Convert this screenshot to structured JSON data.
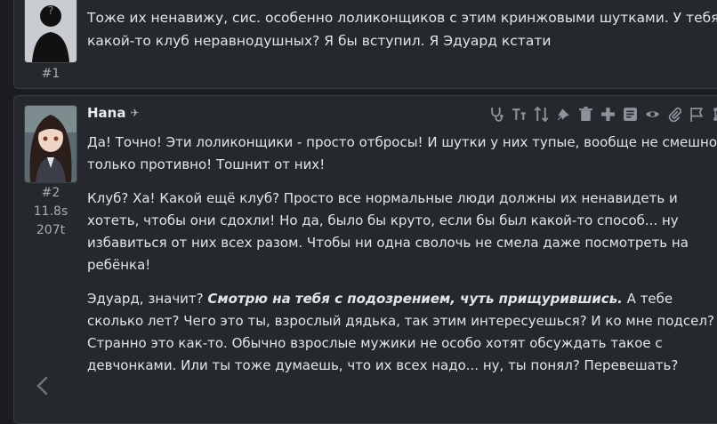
{
  "messages": [
    {
      "number": "#1",
      "text": "Тоже их ненавижу, сис. особенно лоликонщиков с этим кринжовыми шутками. У тебя какой-то клуб неравнодушных? Я бы вступил. Я Эдуард кстати"
    },
    {
      "author": "Hana",
      "number": "#2",
      "time": "11.8s",
      "tokens": "207t",
      "paragraphs": [
        "Да! Точно! Эти лоликонщики - просто отбросы! И шутки у них тупые, вообще не смешно, только противно! Тошнит от них!",
        "Клуб? Ха! Какой ещё клуб? Просто все нормальные люди должны их ненавидеть и хотеть, чтобы они сдохли! Но да, было бы круто, если бы был какой-то способ... ну избавиться от них всех разом. Чтобы ни одна сволочь не смела даже посмотреть на ребёнка!"
      ],
      "p3_start": "Эдуард, значит? ",
      "p3_action": "Смотрю на тебя с подозрением, чуть прищурившись.",
      "p3_rest": " А тебе сколько лет? Чего это ты, взрослый дядька, так этим интересуешься? И ко мне подсел? Странно это как-то. Обычно взрослые мужики не особо хотят обсуждать такое с девчонками. Или ты тоже думаешь, что их всех надо... ну, ты понял? Перевешать?"
    }
  ],
  "toolbar_icons": [
    "stethoscope-icon",
    "text-size-icon",
    "swipe-icon",
    "pin-icon",
    "trash-icon",
    "plus-icon",
    "note-icon",
    "eye-icon",
    "paperclip-icon",
    "flag-icon",
    "branch-icon",
    "edit-icon"
  ],
  "nav": {
    "icon": "chevron-left-icon"
  }
}
